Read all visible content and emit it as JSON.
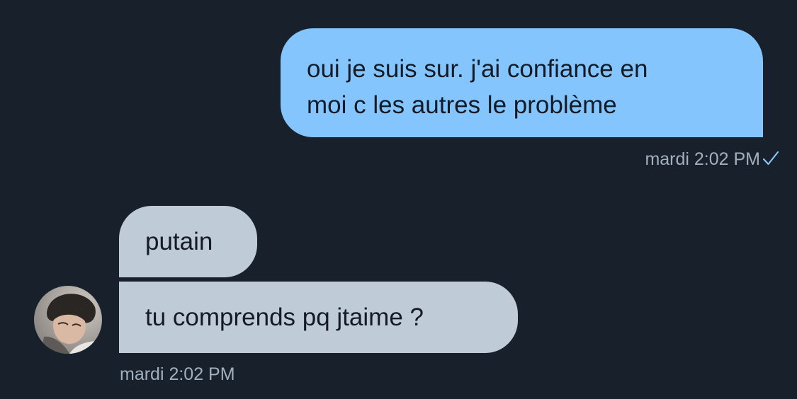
{
  "conversation": {
    "sent": {
      "lines": [
        "oui je suis sur. j'ai confiance en",
        "moi c les autres le problème"
      ],
      "timestamp": "mardi 2:02 PM",
      "status_icon": "checkmark-icon"
    },
    "received": {
      "messages": [
        "putain",
        "tu comprends pq jtaime ?"
      ],
      "timestamp": "mardi 2:02 PM",
      "avatar_icon": "user-avatar"
    }
  },
  "colors": {
    "background": "#18202c",
    "sent_bubble": "#84c5fd",
    "received_bubble": "#bfcbd7",
    "timestamp_text": "#a2afbd",
    "check": "#84c5fd"
  }
}
